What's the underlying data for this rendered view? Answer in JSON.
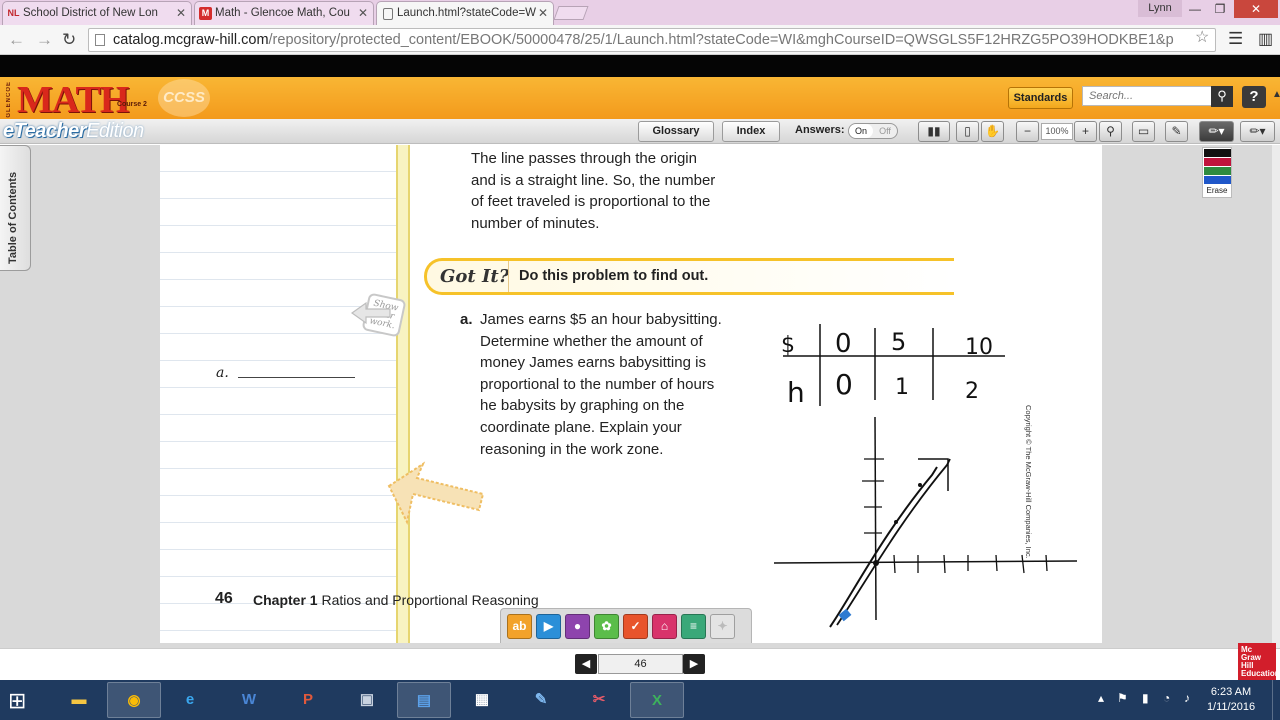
{
  "browser": {
    "tabs": [
      {
        "label": "School District of New Lon",
        "favicon": "NL",
        "active": false
      },
      {
        "label": "Math - Glencoe Math, Cou",
        "favicon": "M",
        "active": false
      },
      {
        "label": "Launch.html?stateCode=W",
        "favicon": "",
        "active": true
      }
    ],
    "user": "Lynn",
    "url_host": "catalog.mcgraw-hill.com",
    "url_path": "/repository/protected_content/EBOOK/50000478/25/1/Launch.html?stateCode=WI&mghCourseID=QWSGLS5F12HRZG5PO39HODKBE1&p"
  },
  "app": {
    "brand_side": "GLENCOE",
    "brand": "MATH",
    "course": "Course 2",
    "ccss_badge": "CCSS",
    "edition_prefix": "eTeacher",
    "edition_suffix": "Edition",
    "standards_label": "Standards",
    "search_placeholder": "Search...",
    "help_label": "?",
    "glossary_label": "Glossary",
    "index_label": "Index",
    "answers_label": "Answers:",
    "answers_on": "On",
    "answers_off": "Off",
    "zoom": "100%",
    "toc_label": "Table of Contents",
    "erase_label": "Erase",
    "pen_colors": [
      "#111111",
      "#c0143c",
      "#2e8b3f",
      "#1f57c9"
    ]
  },
  "page": {
    "intro_lines": [
      "The line passes through the origin",
      "and is a straight line. So, the number",
      "of feet traveled is proportional to the",
      "number of minutes."
    ],
    "got_it_title": "Got It?",
    "got_it_text": "Do this problem to find out.",
    "problem_letter": "a.",
    "problem_lines": [
      "James earns $5 an hour babysitting.",
      "Determine whether the amount of",
      "money James earns babysitting is",
      "proportional to the number of hours",
      "he babysits by graphing on the",
      "coordinate plane. Explain your",
      "reasoning in the work zone."
    ],
    "show_work": "Show your work.",
    "answer_label": "a.",
    "page_number": "46",
    "chapter_label": "Chapter 1",
    "chapter_title": "Ratios and Proportional Reasoning",
    "copyright": "Copyright © The McGraw-Hill Companies, Inc.",
    "handwritten_table": {
      "rows": [
        [
          "$",
          "0",
          "5",
          "10"
        ],
        [
          "h",
          "0",
          "1",
          "2"
        ]
      ]
    }
  },
  "pager": {
    "current_page": "46",
    "publisher": "Mc Graw Hill Education"
  },
  "taskbar": {
    "clock_time": "6:23 AM",
    "clock_date": "1/11/2016"
  }
}
